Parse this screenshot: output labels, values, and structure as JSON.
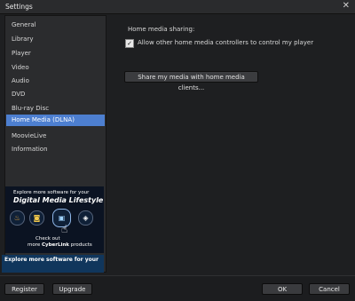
{
  "window": {
    "title": "Settings",
    "close_glyph": "✕"
  },
  "sidebar": {
    "items": [
      {
        "label": "General"
      },
      {
        "label": "Library"
      },
      {
        "label": "Player"
      },
      {
        "label": "Video"
      },
      {
        "label": "Audio"
      },
      {
        "label": "DVD"
      },
      {
        "label": "Blu-ray Disc"
      },
      {
        "label": "Home Media (DLNA)",
        "selected": true
      },
      {
        "label": "MoovieLive"
      },
      {
        "label": "Information"
      }
    ],
    "ad": {
      "line1": "Explore more software for your",
      "line2": "Digital Media Lifestyle",
      "line3": "Check out",
      "line4_prefix": "more ",
      "line4_bold": "CyberLink",
      "line4_suffix": " products",
      "banner": "Explore more software for your"
    }
  },
  "main": {
    "heading": "Home media sharing:",
    "allow_checkbox": {
      "label": "Allow other home media controllers to control my player",
      "checked": true
    },
    "share_button": "Share my media with home media clients..."
  },
  "footer": {
    "register": "Register",
    "upgrade": "Upgrade",
    "ok": "OK",
    "cancel": "Cancel"
  },
  "colors": {
    "accent": "#4d7fd0",
    "background": "#1e1f21"
  }
}
